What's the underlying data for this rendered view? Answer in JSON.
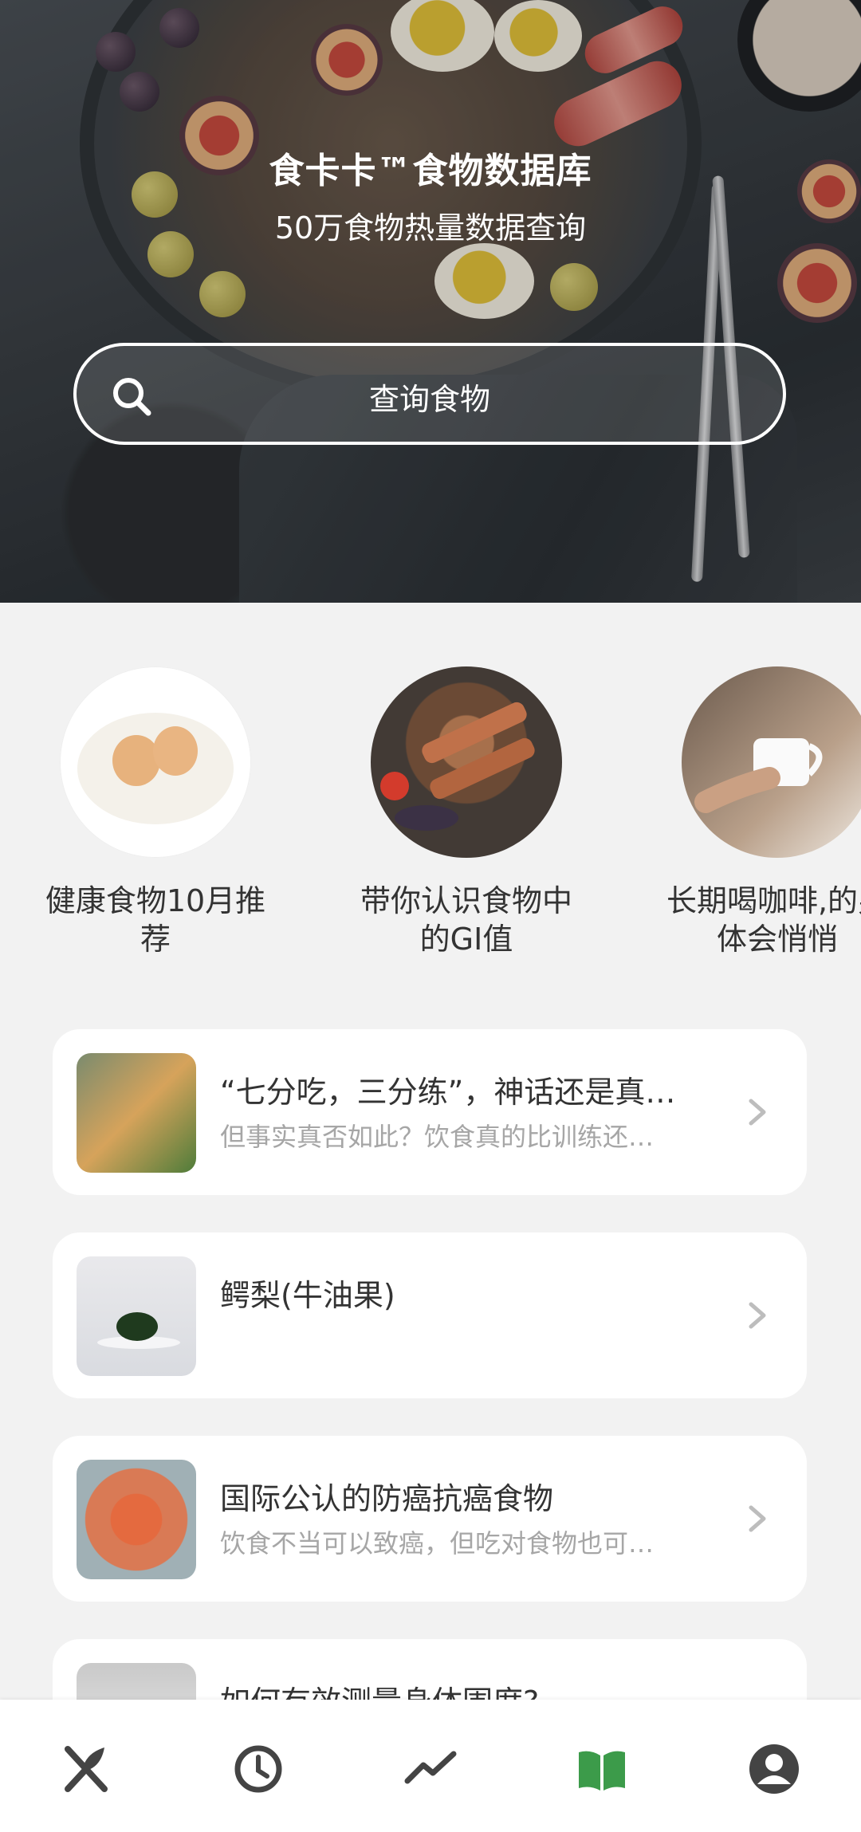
{
  "hero": {
    "title": "食卡卡™食物数据库",
    "subtitle": "50万食物热量数据查询",
    "search_label": "查询食物"
  },
  "carousel": [
    {
      "label": "健康食物10月推荐"
    },
    {
      "label": "带你认识食物中的GI值"
    },
    {
      "label": "长期喝咖啡,的身体会悄悄"
    }
  ],
  "articles": [
    {
      "title": "“七分吃，三分练”，神话还是真…",
      "subtitle": "但事实真否如此？饮食真的比训练还…"
    },
    {
      "title": "鳄梨(牛油果)",
      "subtitle": ""
    },
    {
      "title": "国际公认的防癌抗癌食物",
      "subtitle": "饮食不当可以致癌，但吃对食物也可…"
    },
    {
      "title": "如何有效测量身体围度?",
      "subtitle": ""
    }
  ],
  "nav": {
    "items": [
      {
        "icon": "fork-knife-icon",
        "active": false
      },
      {
        "icon": "clock-icon",
        "active": false
      },
      {
        "icon": "trend-chart-icon",
        "active": false
      },
      {
        "icon": "book-icon",
        "active": true
      },
      {
        "icon": "user-icon",
        "active": false
      }
    ],
    "active_color": "#3c9b4a",
    "inactive_color": "#444444"
  }
}
